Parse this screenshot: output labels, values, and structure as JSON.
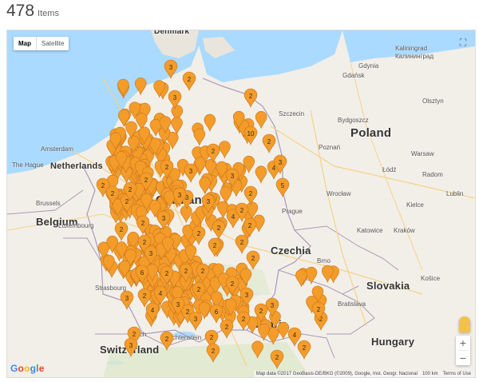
{
  "header": {
    "count": "478",
    "count_label": "Items"
  },
  "map_controls": {
    "map_type": [
      "Map",
      "Satellite"
    ],
    "zoom_in": "+",
    "zoom_out": "−",
    "fullscreen": "⛶"
  },
  "google_logo": [
    "G",
    "o",
    "o",
    "g",
    "l",
    "e"
  ],
  "attribution": {
    "data": "Map data ©2017 GeoBasis-DE/BKG (©2009), Google, Inst. Geogr. Nacional",
    "scale": "100 km",
    "terms": "Terms of Use"
  },
  "countries": [
    "Denmark",
    "Poland",
    "Netherlands",
    "Belgium",
    "Germany",
    "Czechia",
    "Slovakia",
    "Austria",
    "Hungary",
    "Switzerland",
    "Luxembourg",
    "Liechtenstein"
  ],
  "cities": [
    "Gdynia",
    "Gdańsk",
    "Kaliningrad",
    "Калининград",
    "Szczecin",
    "Bydgoszcz",
    "Warsaw",
    "Łódź",
    "Wrocław",
    "Katowice",
    "Kraków",
    "Brno",
    "Košice",
    "Bratislava",
    "Prague",
    "Amsterdam",
    "The Hague",
    "Brussels",
    "Strasbourg",
    "Zürich",
    "Olsztyn",
    "Lublin",
    "Radom",
    "Kielce",
    "Poznań"
  ],
  "clusters": [
    "3",
    "2",
    "3",
    "2",
    "2",
    "4",
    "3",
    "10",
    "2",
    "3",
    "3",
    "3",
    "2",
    "3",
    "4",
    "2",
    "2",
    "5",
    "2",
    "3",
    "2",
    "6",
    "2",
    "2",
    "2",
    "3",
    "2",
    "3",
    "2",
    "2",
    "6",
    "2",
    "2",
    "4",
    "3",
    "2",
    "4",
    "2",
    "2",
    "2",
    "3",
    "2",
    "2",
    "2",
    "2",
    "2",
    "2",
    "2",
    "3",
    "2",
    "2",
    "2",
    "2",
    "3",
    "2",
    "2",
    "2",
    "2",
    "3",
    "2",
    "2",
    "4",
    "3",
    "3",
    "2",
    "2"
  ]
}
